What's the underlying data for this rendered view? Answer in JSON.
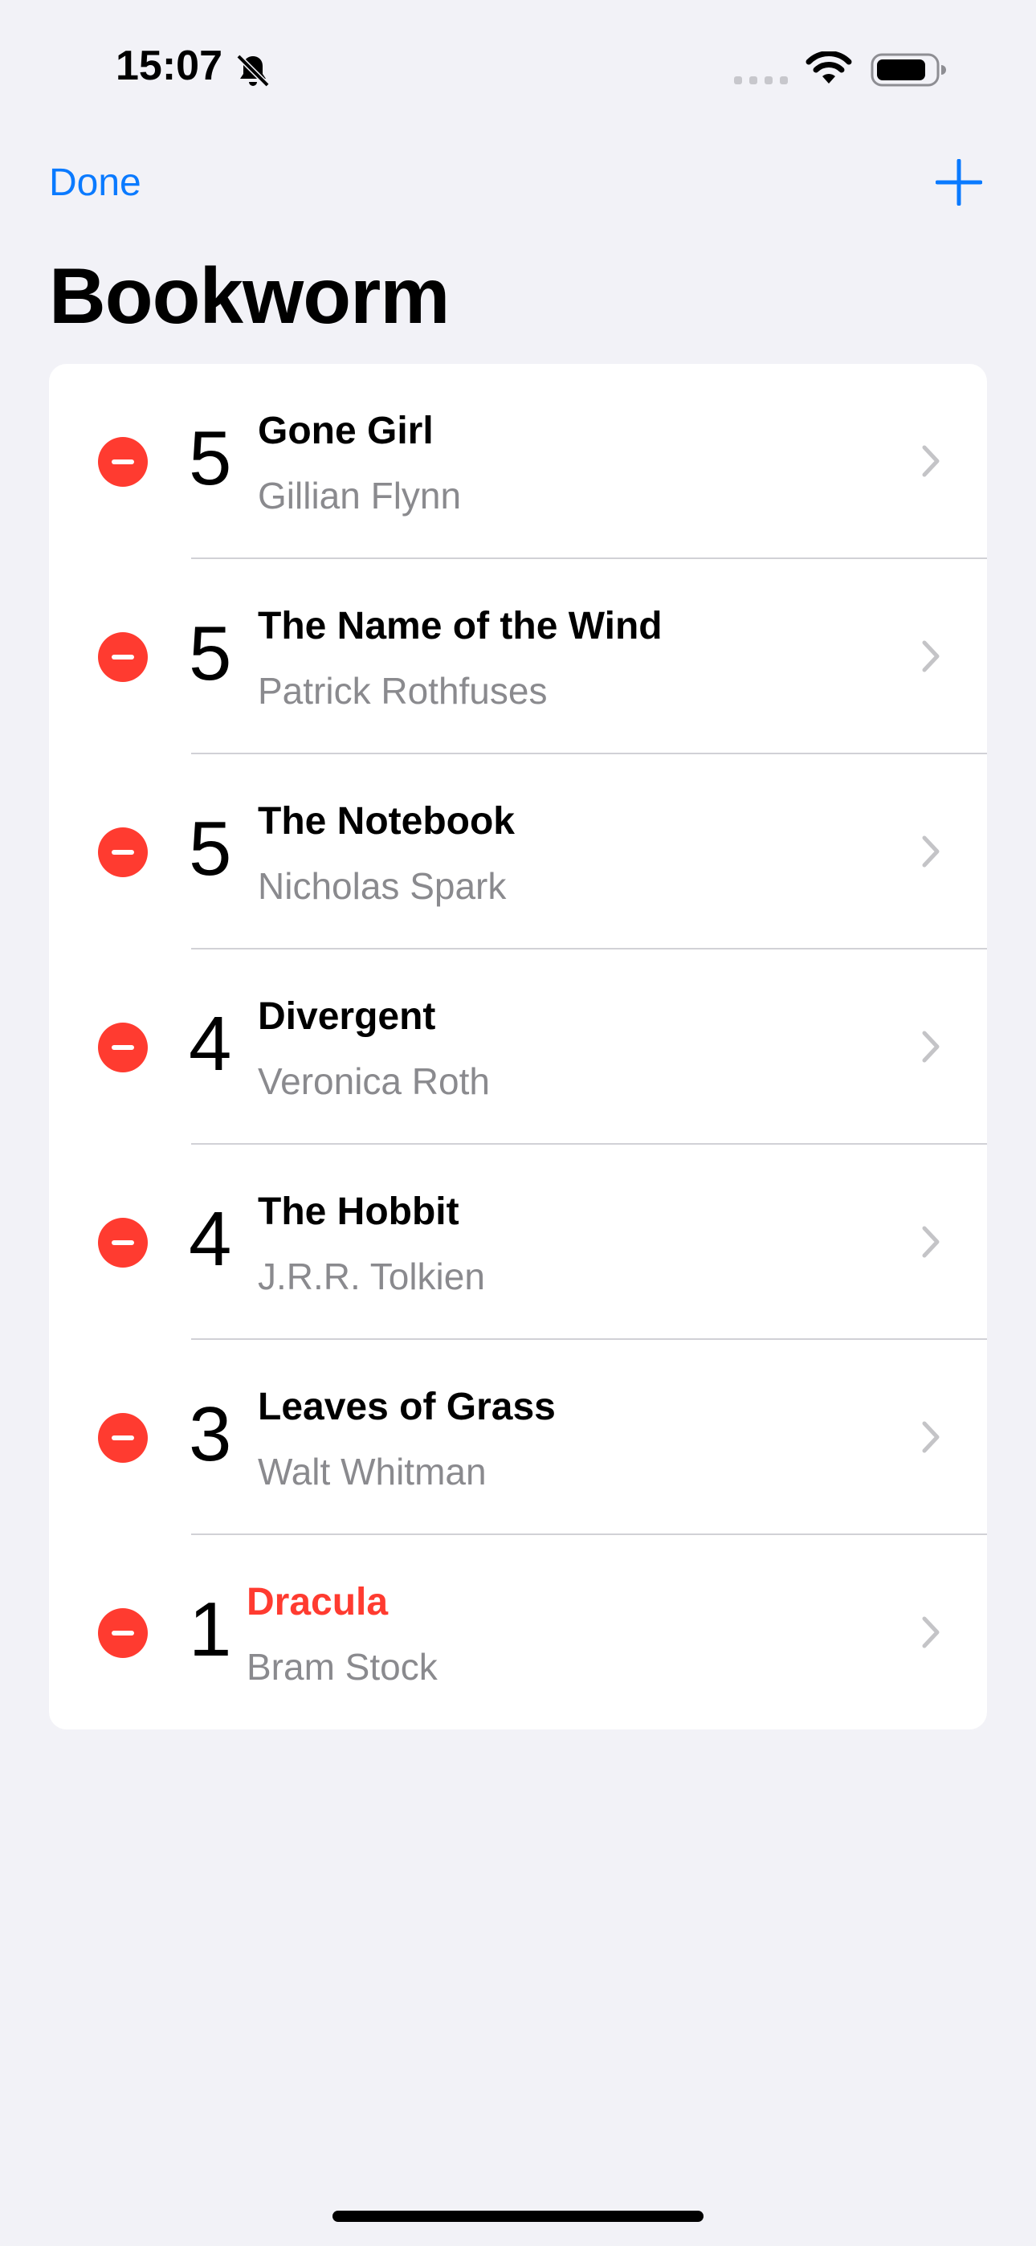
{
  "status_bar": {
    "time": "15:07"
  },
  "nav": {
    "done_label": "Done",
    "title": "Bookworm"
  },
  "books": [
    {
      "rating": "5",
      "title": "Gone Girl",
      "author": "Gillian Flynn"
    },
    {
      "rating": "5",
      "title": "The Name of the Wind",
      "author": "Patrick Rothfuses"
    },
    {
      "rating": "5",
      "title": "The Notebook",
      "author": "Nicholas Spark"
    },
    {
      "rating": "4",
      "title": "Divergent",
      "author": "Veronica Roth"
    },
    {
      "rating": "4",
      "title": "The Hobbit",
      "author": "J.R.R. Tolkien"
    },
    {
      "rating": "3",
      "title": "Leaves of Grass",
      "author": "Walt Whitman"
    },
    {
      "rating": "1",
      "title": "Dracula",
      "author": "Bram Stock"
    }
  ],
  "colors": {
    "accent": "#0A7AFF",
    "destructive": "#FF3B30",
    "secondary_text": "#8A8A8E",
    "background": "#F2F2F7"
  },
  "icons": [
    "bell-slash-icon",
    "cellular-signal-icon",
    "wifi-icon",
    "battery-icon",
    "plus-icon",
    "delete-circle-icon",
    "chevron-right-icon"
  ]
}
